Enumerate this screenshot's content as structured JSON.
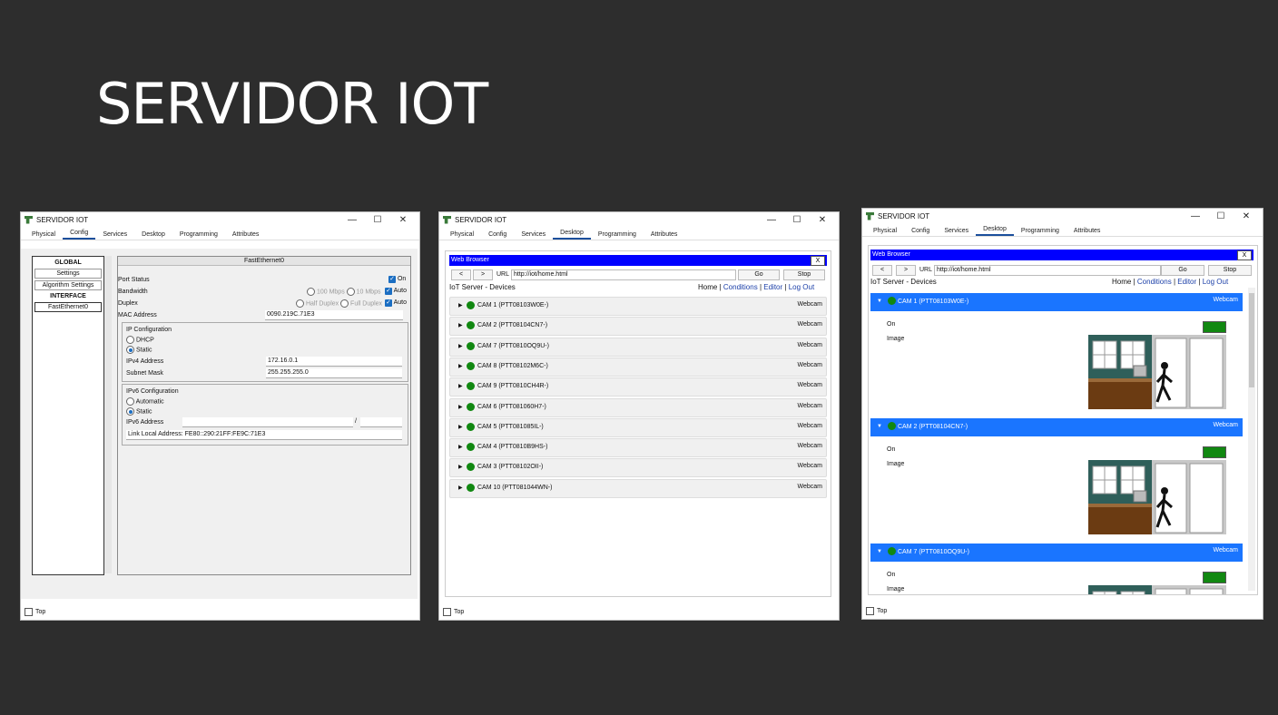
{
  "slide": {
    "title": "SERVIDOR IOT"
  },
  "window_controls": {
    "minimize": "—",
    "maximize": "☐",
    "close": "✕"
  },
  "win1": {
    "title": "SERVIDOR IOT",
    "tabs": [
      "Physical",
      "Config",
      "Services",
      "Desktop",
      "Programming",
      "Attributes"
    ],
    "active_tab": "Config",
    "left": {
      "global": "GLOBAL",
      "settings": "Settings",
      "algorithm": "Algorithm Settings",
      "interface": "INTERFACE",
      "fastethernet": "FastEthernet0"
    },
    "panel_header": "FastEthernet0",
    "port_status": "Port Status",
    "on_label": "On",
    "bandwidth": "Bandwidth",
    "bw_100": "100 Mbps",
    "bw_10": "10 Mbps",
    "auto": "Auto",
    "duplex": "Duplex",
    "half": "Half Duplex",
    "full": "Full Duplex",
    "mac_label": "MAC Address",
    "mac_value": "0090.219C.71E3",
    "ipconf": "IP Configuration",
    "dhcp": "DHCP",
    "static": "Static",
    "ipv4_label": "IPv4 Address",
    "ipv4_value": "172.16.0.1",
    "mask_label": "Subnet Mask",
    "mask_value": "255.255.255.0",
    "ipv6conf": "IPv6 Configuration",
    "automatic": "Automatic",
    "ipv6_label": "IPv6 Address",
    "slash": "/",
    "link_local": "Link Local Address: FE80::290:21FF:FE9C:71E3",
    "top": "Top"
  },
  "browser": {
    "title": "SERVIDOR IOT",
    "tabs": [
      "Physical",
      "Config",
      "Services",
      "Desktop",
      "Programming",
      "Attributes"
    ],
    "active_tab": "Desktop",
    "bar_title": "Web Browser",
    "close": "X",
    "back": "<",
    "fwd": ">",
    "url_label": "URL",
    "url": "http://iot/home.html",
    "go": "Go",
    "stop": "Stop",
    "server_title": "IoT Server - Devices",
    "nav": {
      "home": "Home",
      "conditions": "Conditions",
      "editor": "Editor",
      "logout": "Log Out",
      "sep": "|"
    },
    "top": "Top"
  },
  "cams_collapsed": [
    {
      "name": "CAM 1 (PTT08103W0E-)",
      "type": "Webcam"
    },
    {
      "name": "CAM 2 (PTT08104CN7-)",
      "type": "Webcam"
    },
    {
      "name": "CAM 7 (PTT0810OQ9U-)",
      "type": "Webcam"
    },
    {
      "name": "CAM 8 (PTT08102M6C-)",
      "type": "Webcam"
    },
    {
      "name": "CAM 9 (PTT0810CH4R-)",
      "type": "Webcam"
    },
    {
      "name": "CAM 6 (PTT081060H7-)",
      "type": "Webcam"
    },
    {
      "name": "CAM 5 (PTT081085IL-)",
      "type": "Webcam"
    },
    {
      "name": "CAM 4 (PTT0810B9HS-)",
      "type": "Webcam"
    },
    {
      "name": "CAM 3 (PTT08102OII-)",
      "type": "Webcam"
    },
    {
      "name": "CAM 10 (PTT081044WN-)",
      "type": "Webcam"
    }
  ],
  "cams_expanded": [
    {
      "name": "CAM 1 (PTT08103W0E-)",
      "type": "Webcam",
      "on": "On",
      "image": "Image"
    },
    {
      "name": "CAM 2 (PTT08104CN7-)",
      "type": "Webcam",
      "on": "On",
      "image": "Image"
    },
    {
      "name": "CAM 7 (PTT0810OQ9U-)",
      "type": "Webcam",
      "on": "On",
      "image": "Image"
    }
  ],
  "colors": {
    "browser_bar": "#0000ff",
    "cam_header": "#1a75ff",
    "status_green": "#118811"
  }
}
